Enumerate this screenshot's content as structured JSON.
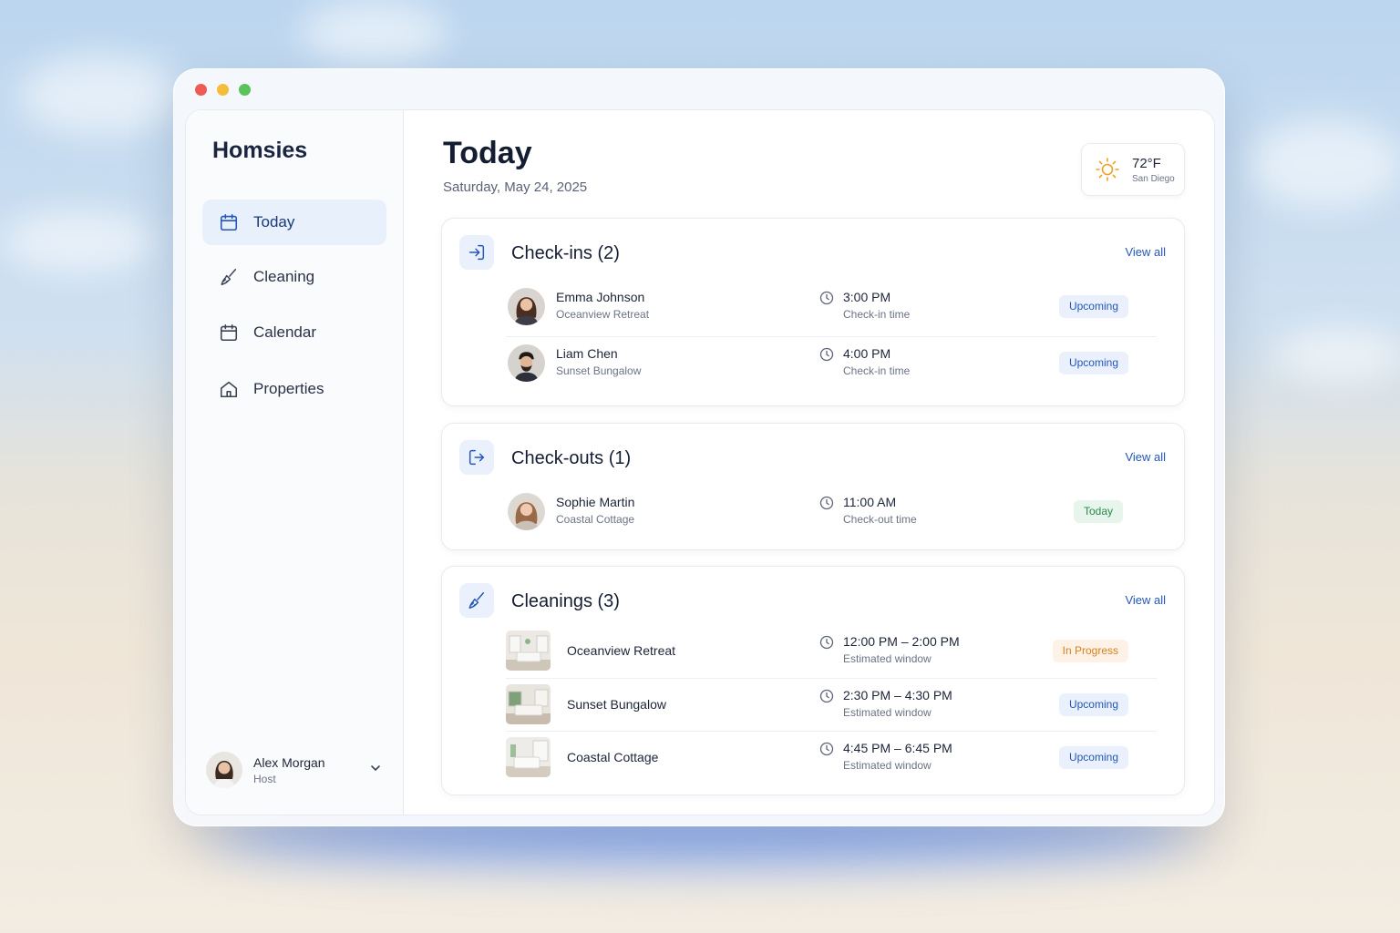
{
  "app": {
    "name": "Homsies"
  },
  "sidebar": {
    "items": [
      {
        "label": "Today",
        "icon": "calendar-icon",
        "active": true
      },
      {
        "label": "Cleaning",
        "icon": "broom-icon"
      },
      {
        "label": "Calendar",
        "icon": "calendar-icon"
      },
      {
        "label": "Properties",
        "icon": "home-icon"
      }
    ]
  },
  "user": {
    "name": "Alex Morgan",
    "role": "Host"
  },
  "header": {
    "title": "Today",
    "date": "Saturday, May 24, 2025"
  },
  "weather": {
    "temp": "72°F",
    "city": "San Diego",
    "icon": "sun-icon"
  },
  "checkins": {
    "title": "Check-ins (2)",
    "view_all": "View all",
    "rows": [
      {
        "name": "Emma Johnson",
        "property": "Oceanview Retreat",
        "time": "3:00 PM",
        "time_label": "Check-in time",
        "status": "Upcoming"
      },
      {
        "name": "Liam Chen",
        "property": "Sunset Bungalow",
        "time": "4:00 PM",
        "time_label": "Check-in time",
        "status": "Upcoming"
      }
    ]
  },
  "checkouts": {
    "title": "Check-outs (1)",
    "view_all": "View all",
    "rows": [
      {
        "name": "Sophie Martin",
        "property": "Coastal Cottage",
        "time": "11:00 AM",
        "time_label": "Check-out time",
        "status": "Today"
      }
    ]
  },
  "cleanings": {
    "title": "Cleanings (3)",
    "view_all": "View all",
    "rows": [
      {
        "property": "Oceanview Retreat",
        "time": "12:00 PM – 2:00 PM",
        "time_label": "Estimated window",
        "status": "In Progress"
      },
      {
        "property": "Sunset Bungalow",
        "time": "2:30 PM – 4:30 PM",
        "time_label": "Estimated window",
        "status": "Upcoming"
      },
      {
        "property": "Coastal Cottage",
        "time": "4:45 PM – 6:45 PM",
        "time_label": "Estimated window",
        "status": "Upcoming"
      }
    ]
  },
  "colors": {
    "accent": "#2456b8",
    "upcoming": "#2456b8",
    "today": "#2a8a4a",
    "in_progress": "#d7801c"
  }
}
